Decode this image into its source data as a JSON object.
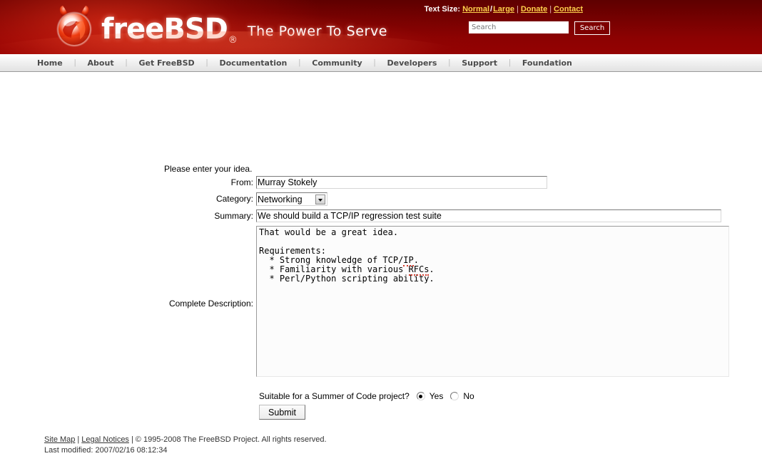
{
  "header": {
    "logo_text": "freeBSD",
    "registered_mark": "®",
    "tagline": "The Power To Serve",
    "text_size_label": "Text Size:",
    "links": [
      {
        "label": "Normal"
      },
      {
        "label": "Large"
      },
      {
        "label": "Donate"
      },
      {
        "label": "Contact"
      }
    ],
    "slash": "/",
    "separator": "|",
    "search": {
      "placeholder": "Search",
      "value": "",
      "button_label": "Search"
    }
  },
  "nav": {
    "items": [
      {
        "label": "Home"
      },
      {
        "label": "About"
      },
      {
        "label": "Get FreeBSD"
      },
      {
        "label": "Documentation"
      },
      {
        "label": "Community"
      },
      {
        "label": "Developers"
      },
      {
        "label": "Support"
      },
      {
        "label": "Foundation"
      }
    ],
    "separator": "|"
  },
  "form": {
    "intro": "Please enter your idea.",
    "from": {
      "label": "From:",
      "value": "Murray Stokely",
      "placeholder": ""
    },
    "category": {
      "label": "Category:",
      "value": "Networking",
      "options": [
        "Networking"
      ]
    },
    "summary": {
      "label": "Summary:",
      "value": "We should build a TCP/IP regression test suite",
      "placeholder": ""
    },
    "description": {
      "label": "Complete Description:",
      "value": "That would be a great idea.\n\nRequirements:\n  * Strong knowledge of TCP/IP.\n  * Familiarity with various RFCs.\n  * Perl/Python scripting ability.",
      "misspelled_words": [
        "IP",
        "RFCs"
      ]
    },
    "soc": {
      "question": "Suitable for a Summer of Code project?",
      "options": [
        {
          "label": "Yes",
          "selected": true
        },
        {
          "label": "No",
          "selected": false
        }
      ]
    },
    "submit_label": "Submit"
  },
  "footer": {
    "site_map": "Site Map",
    "legal_notices": "Legal Notices",
    "separator": "|",
    "copyright": "© 1995-2008 The FreeBSD Project. All rights reserved.",
    "last_modified": "Last modified: 2007/02/16 08:12:34"
  },
  "colors": {
    "brand_red": "#8c0202",
    "header_dark": "#5e0000",
    "link_gold": "#ffd24d",
    "nav_text": "#4b4b4b"
  }
}
